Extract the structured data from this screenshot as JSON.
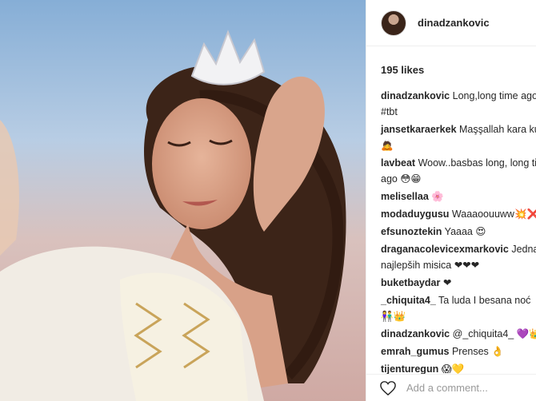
{
  "post": {
    "author": "dinadzankovic",
    "likes_text": "195 likes"
  },
  "comments": [
    {
      "user": "dinadzankovic",
      "lines": [
        "Long,long time ago",
        "#tbt"
      ]
    },
    {
      "user": "jansetkaraerkek",
      "lines": [
        "Maşşallah kara kuş",
        "🙇"
      ]
    },
    {
      "user": "lavbeat",
      "lines": [
        "Woow..basbas long, long time",
        "ago 😳😁"
      ]
    },
    {
      "user": "melisellaa",
      "lines": [
        "🌸"
      ]
    },
    {
      "user": "modaduygusu",
      "lines": [
        "Waaaoouuww💥❌"
      ]
    },
    {
      "user": "efsunoztekin",
      "lines": [
        "Yaaaa 😍"
      ]
    },
    {
      "user": "draganacolevicexmarkovic",
      "lines": [
        "Jedna",
        "najlepših misica ❤❤❤"
      ]
    },
    {
      "user": "buketbaydar",
      "lines": [
        "❤"
      ]
    },
    {
      "user": "_chiquita4_",
      "lines": [
        "Ta luda I besana noć",
        "👫👑"
      ]
    },
    {
      "user": "dinadzankovic",
      "lines": [
        "@_chiquita4_ 💜👑"
      ]
    },
    {
      "user": "emrah_gumus",
      "lines": [
        "Prenses 👌"
      ]
    },
    {
      "user": "tijenturegun",
      "lines": [
        "😱💛"
      ]
    }
  ],
  "add_comment": {
    "placeholder": "Add a comment..."
  },
  "icons": {
    "like": "heart-icon"
  }
}
